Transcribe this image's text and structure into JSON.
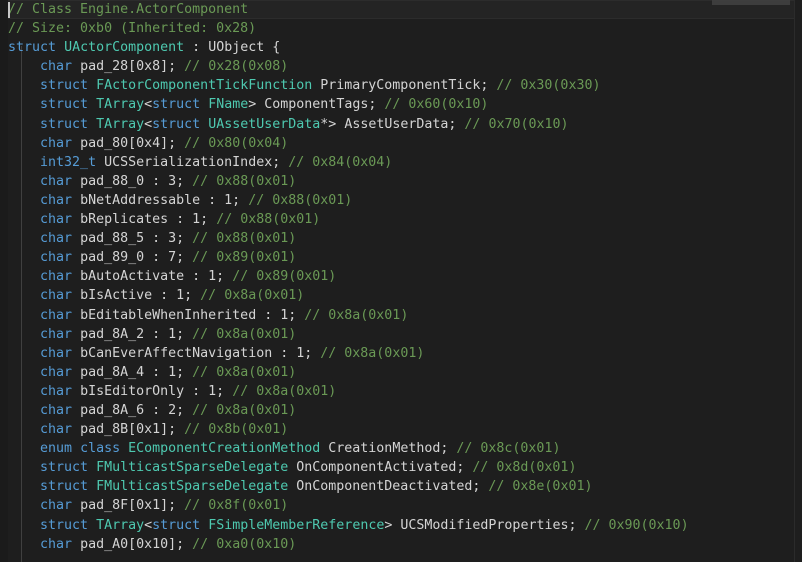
{
  "editor": {
    "title": "code-editor",
    "language": "cpp",
    "theme": "dark-plus",
    "colors": {
      "background": "#1e1e1e",
      "gutter": "#1b1b1b",
      "active_line": "#242424",
      "comment": "#6a9955",
      "keyword": "#569cd6",
      "type": "#4ec9b0",
      "identifier": "#d4d4d4",
      "number": "#b5cea8",
      "indent_guide": "#404040",
      "scrollbar_thumb": "#424242",
      "caret": "#c8c8c8"
    },
    "scrollbar": {
      "orientation": "horizontal",
      "position": "top"
    },
    "caret_line": 1
  },
  "code": {
    "lines": [
      {
        "active": true,
        "tokens": [
          {
            "t": "// Class Engine.ActorComponent",
            "k": "c"
          }
        ]
      },
      {
        "active": false,
        "tokens": [
          {
            "t": "// Size: 0xb0 (Inherited: 0x28)",
            "k": "c"
          }
        ]
      },
      {
        "active": false,
        "tokens": [
          {
            "t": "struct",
            "k": "kw"
          },
          {
            "t": " ",
            "k": "id"
          },
          {
            "t": "UActorComponent",
            "k": "ty"
          },
          {
            "t": " : ",
            "k": "pn"
          },
          {
            "t": "UObject",
            "k": "id"
          },
          {
            "t": " {",
            "k": "pn"
          }
        ]
      },
      {
        "active": false,
        "tokens": [
          {
            "t": "    ",
            "k": "id"
          },
          {
            "t": "char",
            "k": "kw"
          },
          {
            "t": " ",
            "k": "id"
          },
          {
            "t": "pad_28[0x8];",
            "k": "id"
          },
          {
            "t": " ",
            "k": "id"
          },
          {
            "t": "// 0x28(0x08)",
            "k": "c"
          }
        ]
      },
      {
        "active": false,
        "tokens": [
          {
            "t": "    ",
            "k": "id"
          },
          {
            "t": "struct",
            "k": "kw"
          },
          {
            "t": " ",
            "k": "id"
          },
          {
            "t": "FActorComponentTickFunction",
            "k": "ty"
          },
          {
            "t": " PrimaryComponentTick;",
            "k": "id"
          },
          {
            "t": " ",
            "k": "id"
          },
          {
            "t": "// 0x30(0x30)",
            "k": "c"
          }
        ]
      },
      {
        "active": false,
        "tokens": [
          {
            "t": "    ",
            "k": "id"
          },
          {
            "t": "struct",
            "k": "kw"
          },
          {
            "t": " ",
            "k": "id"
          },
          {
            "t": "TArray",
            "k": "ty"
          },
          {
            "t": "<",
            "k": "pn"
          },
          {
            "t": "struct",
            "k": "kw"
          },
          {
            "t": " ",
            "k": "id"
          },
          {
            "t": "FName",
            "k": "ty"
          },
          {
            "t": "> ",
            "k": "pn"
          },
          {
            "t": "ComponentTags;",
            "k": "id"
          },
          {
            "t": " ",
            "k": "id"
          },
          {
            "t": "// 0x60(0x10)",
            "k": "c"
          }
        ]
      },
      {
        "active": false,
        "tokens": [
          {
            "t": "    ",
            "k": "id"
          },
          {
            "t": "struct",
            "k": "kw"
          },
          {
            "t": " ",
            "k": "id"
          },
          {
            "t": "TArray",
            "k": "ty"
          },
          {
            "t": "<",
            "k": "pn"
          },
          {
            "t": "struct",
            "k": "kw"
          },
          {
            "t": " ",
            "k": "id"
          },
          {
            "t": "UAssetUserData",
            "k": "ty"
          },
          {
            "t": "*> ",
            "k": "pn"
          },
          {
            "t": "AssetUserData;",
            "k": "id"
          },
          {
            "t": " ",
            "k": "id"
          },
          {
            "t": "// 0x70(0x10)",
            "k": "c"
          }
        ]
      },
      {
        "active": false,
        "tokens": [
          {
            "t": "    ",
            "k": "id"
          },
          {
            "t": "char",
            "k": "kw"
          },
          {
            "t": " ",
            "k": "id"
          },
          {
            "t": "pad_80[0x4];",
            "k": "id"
          },
          {
            "t": " ",
            "k": "id"
          },
          {
            "t": "// 0x80(0x04)",
            "k": "c"
          }
        ]
      },
      {
        "active": false,
        "tokens": [
          {
            "t": "    ",
            "k": "id"
          },
          {
            "t": "int32_t",
            "k": "kw"
          },
          {
            "t": " ",
            "k": "id"
          },
          {
            "t": "UCSSerializationIndex;",
            "k": "id"
          },
          {
            "t": " ",
            "k": "id"
          },
          {
            "t": "// 0x84(0x04)",
            "k": "c"
          }
        ]
      },
      {
        "active": false,
        "tokens": [
          {
            "t": "    ",
            "k": "id"
          },
          {
            "t": "char",
            "k": "kw"
          },
          {
            "t": " ",
            "k": "id"
          },
          {
            "t": "pad_88_0 : 3;",
            "k": "id"
          },
          {
            "t": " ",
            "k": "id"
          },
          {
            "t": "// 0x88(0x01)",
            "k": "c"
          }
        ]
      },
      {
        "active": false,
        "tokens": [
          {
            "t": "    ",
            "k": "id"
          },
          {
            "t": "char",
            "k": "kw"
          },
          {
            "t": " ",
            "k": "id"
          },
          {
            "t": "bNetAddressable : 1;",
            "k": "id"
          },
          {
            "t": " ",
            "k": "id"
          },
          {
            "t": "// 0x88(0x01)",
            "k": "c"
          }
        ]
      },
      {
        "active": false,
        "tokens": [
          {
            "t": "    ",
            "k": "id"
          },
          {
            "t": "char",
            "k": "kw"
          },
          {
            "t": " ",
            "k": "id"
          },
          {
            "t": "bReplicates : 1;",
            "k": "id"
          },
          {
            "t": " ",
            "k": "id"
          },
          {
            "t": "// 0x88(0x01)",
            "k": "c"
          }
        ]
      },
      {
        "active": false,
        "tokens": [
          {
            "t": "    ",
            "k": "id"
          },
          {
            "t": "char",
            "k": "kw"
          },
          {
            "t": " ",
            "k": "id"
          },
          {
            "t": "pad_88_5 : 3;",
            "k": "id"
          },
          {
            "t": " ",
            "k": "id"
          },
          {
            "t": "// 0x88(0x01)",
            "k": "c"
          }
        ]
      },
      {
        "active": false,
        "tokens": [
          {
            "t": "    ",
            "k": "id"
          },
          {
            "t": "char",
            "k": "kw"
          },
          {
            "t": " ",
            "k": "id"
          },
          {
            "t": "pad_89_0 : 7;",
            "k": "id"
          },
          {
            "t": " ",
            "k": "id"
          },
          {
            "t": "// 0x89(0x01)",
            "k": "c"
          }
        ]
      },
      {
        "active": false,
        "tokens": [
          {
            "t": "    ",
            "k": "id"
          },
          {
            "t": "char",
            "k": "kw"
          },
          {
            "t": " ",
            "k": "id"
          },
          {
            "t": "bAutoActivate : 1;",
            "k": "id"
          },
          {
            "t": " ",
            "k": "id"
          },
          {
            "t": "// 0x89(0x01)",
            "k": "c"
          }
        ]
      },
      {
        "active": false,
        "tokens": [
          {
            "t": "    ",
            "k": "id"
          },
          {
            "t": "char",
            "k": "kw"
          },
          {
            "t": " ",
            "k": "id"
          },
          {
            "t": "bIsActive : 1;",
            "k": "id"
          },
          {
            "t": " ",
            "k": "id"
          },
          {
            "t": "// 0x8a(0x01)",
            "k": "c"
          }
        ]
      },
      {
        "active": false,
        "tokens": [
          {
            "t": "    ",
            "k": "id"
          },
          {
            "t": "char",
            "k": "kw"
          },
          {
            "t": " ",
            "k": "id"
          },
          {
            "t": "bEditableWhenInherited : 1;",
            "k": "id"
          },
          {
            "t": " ",
            "k": "id"
          },
          {
            "t": "// 0x8a(0x01)",
            "k": "c"
          }
        ]
      },
      {
        "active": false,
        "tokens": [
          {
            "t": "    ",
            "k": "id"
          },
          {
            "t": "char",
            "k": "kw"
          },
          {
            "t": " ",
            "k": "id"
          },
          {
            "t": "pad_8A_2 : 1;",
            "k": "id"
          },
          {
            "t": " ",
            "k": "id"
          },
          {
            "t": "// 0x8a(0x01)",
            "k": "c"
          }
        ]
      },
      {
        "active": false,
        "tokens": [
          {
            "t": "    ",
            "k": "id"
          },
          {
            "t": "char",
            "k": "kw"
          },
          {
            "t": " ",
            "k": "id"
          },
          {
            "t": "bCanEverAffectNavigation : 1;",
            "k": "id"
          },
          {
            "t": " ",
            "k": "id"
          },
          {
            "t": "// 0x8a(0x01)",
            "k": "c"
          }
        ]
      },
      {
        "active": false,
        "tokens": [
          {
            "t": "    ",
            "k": "id"
          },
          {
            "t": "char",
            "k": "kw"
          },
          {
            "t": " ",
            "k": "id"
          },
          {
            "t": "pad_8A_4 : 1;",
            "k": "id"
          },
          {
            "t": " ",
            "k": "id"
          },
          {
            "t": "// 0x8a(0x01)",
            "k": "c"
          }
        ]
      },
      {
        "active": false,
        "tokens": [
          {
            "t": "    ",
            "k": "id"
          },
          {
            "t": "char",
            "k": "kw"
          },
          {
            "t": " ",
            "k": "id"
          },
          {
            "t": "bIsEditorOnly : 1;",
            "k": "id"
          },
          {
            "t": " ",
            "k": "id"
          },
          {
            "t": "// 0x8a(0x01)",
            "k": "c"
          }
        ]
      },
      {
        "active": false,
        "tokens": [
          {
            "t": "    ",
            "k": "id"
          },
          {
            "t": "char",
            "k": "kw"
          },
          {
            "t": " ",
            "k": "id"
          },
          {
            "t": "pad_8A_6 : 2;",
            "k": "id"
          },
          {
            "t": " ",
            "k": "id"
          },
          {
            "t": "// 0x8a(0x01)",
            "k": "c"
          }
        ]
      },
      {
        "active": false,
        "tokens": [
          {
            "t": "    ",
            "k": "id"
          },
          {
            "t": "char",
            "k": "kw"
          },
          {
            "t": " ",
            "k": "id"
          },
          {
            "t": "pad_8B[0x1];",
            "k": "id"
          },
          {
            "t": " ",
            "k": "id"
          },
          {
            "t": "// 0x8b(0x01)",
            "k": "c"
          }
        ]
      },
      {
        "active": false,
        "tokens": [
          {
            "t": "    ",
            "k": "id"
          },
          {
            "t": "enum",
            "k": "kw"
          },
          {
            "t": " ",
            "k": "id"
          },
          {
            "t": "class",
            "k": "kw"
          },
          {
            "t": " ",
            "k": "id"
          },
          {
            "t": "EComponentCreationMethod",
            "k": "ty"
          },
          {
            "t": " CreationMethod;",
            "k": "id"
          },
          {
            "t": " ",
            "k": "id"
          },
          {
            "t": "// 0x8c(0x01)",
            "k": "c"
          }
        ]
      },
      {
        "active": false,
        "tokens": [
          {
            "t": "    ",
            "k": "id"
          },
          {
            "t": "struct",
            "k": "kw"
          },
          {
            "t": " ",
            "k": "id"
          },
          {
            "t": "FMulticastSparseDelegate",
            "k": "ty"
          },
          {
            "t": " OnComponentActivated;",
            "k": "id"
          },
          {
            "t": " ",
            "k": "id"
          },
          {
            "t": "// 0x8d(0x01)",
            "k": "c"
          }
        ]
      },
      {
        "active": false,
        "tokens": [
          {
            "t": "    ",
            "k": "id"
          },
          {
            "t": "struct",
            "k": "kw"
          },
          {
            "t": " ",
            "k": "id"
          },
          {
            "t": "FMulticastSparseDelegate",
            "k": "ty"
          },
          {
            "t": " OnComponentDeactivated;",
            "k": "id"
          },
          {
            "t": " ",
            "k": "id"
          },
          {
            "t": "// 0x8e(0x01)",
            "k": "c"
          }
        ]
      },
      {
        "active": false,
        "tokens": [
          {
            "t": "    ",
            "k": "id"
          },
          {
            "t": "char",
            "k": "kw"
          },
          {
            "t": " ",
            "k": "id"
          },
          {
            "t": "pad_8F[0x1];",
            "k": "id"
          },
          {
            "t": " ",
            "k": "id"
          },
          {
            "t": "// 0x8f(0x01)",
            "k": "c"
          }
        ]
      },
      {
        "active": false,
        "tokens": [
          {
            "t": "    ",
            "k": "id"
          },
          {
            "t": "struct",
            "k": "kw"
          },
          {
            "t": " ",
            "k": "id"
          },
          {
            "t": "TArray",
            "k": "ty"
          },
          {
            "t": "<",
            "k": "pn"
          },
          {
            "t": "struct",
            "k": "kw"
          },
          {
            "t": " ",
            "k": "id"
          },
          {
            "t": "FSimpleMemberReference",
            "k": "ty"
          },
          {
            "t": "> ",
            "k": "pn"
          },
          {
            "t": "UCSModifiedProperties;",
            "k": "id"
          },
          {
            "t": " ",
            "k": "id"
          },
          {
            "t": "// 0x90(0x10)",
            "k": "c"
          }
        ]
      },
      {
        "active": false,
        "tokens": [
          {
            "t": "    ",
            "k": "id"
          },
          {
            "t": "char",
            "k": "kw"
          },
          {
            "t": " ",
            "k": "id"
          },
          {
            "t": "pad_A0[0x10];",
            "k": "id"
          },
          {
            "t": " ",
            "k": "id"
          },
          {
            "t": "// 0xa0(0x10)",
            "k": "c"
          }
        ]
      }
    ]
  }
}
